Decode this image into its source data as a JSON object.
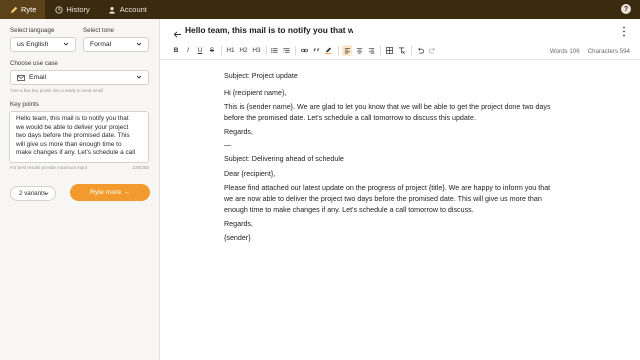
{
  "topbar": {
    "tabs": [
      {
        "label": "Ryte",
        "icon": "pencil-icon",
        "active": true
      },
      {
        "label": "History",
        "icon": "clock-icon",
        "active": false
      },
      {
        "label": "Account",
        "icon": "user-icon",
        "active": false
      }
    ],
    "help_label": "?"
  },
  "sidebar": {
    "language_label": "Select language",
    "language_value": "us English",
    "tone_label": "Select tone",
    "tone_value": "Formal",
    "usecase_label": "Choose use case",
    "usecase_value": "Email",
    "usecase_hint": "Turn a few key points into a ready to send email",
    "keypoints_label": "Key points",
    "keypoints_lines": [
      "Hello team, this mail is to notify you that",
      "we would be able to deliver your project",
      "two days before the promised date. This",
      "will give us more than enough time to",
      "make changes if any. Let's schedule a call"
    ],
    "keypoints_hint": "For best results provide maximum input",
    "char_count": "226/250",
    "variants_value": "2 variants",
    "ryte_button": "Ryte more →"
  },
  "main": {
    "title": "Hello team, this mail is to notify you that we wo",
    "toolbar": {
      "bold": "B",
      "italic": "I",
      "underline": "U",
      "strike": "S",
      "h1": "H1",
      "h2": "H2",
      "h3": "H3"
    },
    "words_label": "Words 106",
    "chars_label": "Characters 594",
    "document": [
      "Subject: Project update",
      "Hi {recipient name},",
      "This is {sender name}. We are glad to let you know that we will be able to get the project done two days",
      "before the promised date. Let's schedule a call tomorrow to discuss this update.",
      "Regards,",
      "—",
      "Subject: Delivering ahead of schedule",
      "Dear {recipient},",
      "Please find attached our latest update on the progress of project {title}. We are happy to inform you that",
      "we are now able to deliver the project two days before the promised date. This will give us more than",
      "enough time to make changes if any. Let's schedule a call tomorrow to discuss.",
      "Regards,",
      "{sender}"
    ]
  },
  "colors": {
    "topbar_bg": "#3a2a10",
    "accent": "#f29a2e",
    "active_tab": "#5b4218"
  }
}
